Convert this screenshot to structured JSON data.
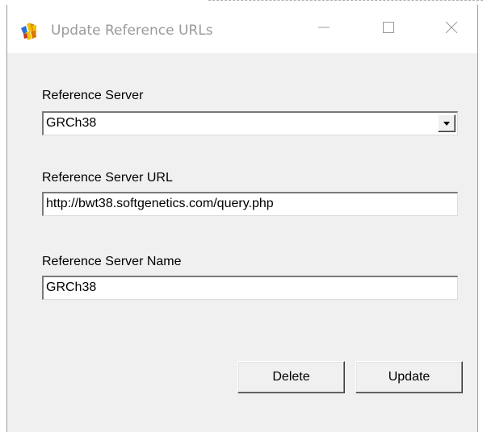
{
  "window": {
    "title": "Update Reference URLs",
    "icons": {
      "app": "app-logo-icon",
      "minimize": "minimize-icon",
      "maximize": "maximize-icon",
      "close": "close-icon"
    }
  },
  "form": {
    "reference_server": {
      "label": "Reference Server",
      "value": "GRCh38",
      "dropdown_icon": "chevron-down-icon"
    },
    "reference_server_url": {
      "label": "Reference Server URL",
      "value": "http://bwt38.softgenetics.com/query.php"
    },
    "reference_server_name": {
      "label": "Reference Server Name",
      "value": "GRCh38"
    }
  },
  "buttons": {
    "delete_label": "Delete",
    "update_label": "Update"
  },
  "colors": {
    "window_bg": "#f0f0f0",
    "titlebar_bg": "#ffffff",
    "title_text": "#9a9a9a",
    "field_bg": "#ffffff"
  }
}
